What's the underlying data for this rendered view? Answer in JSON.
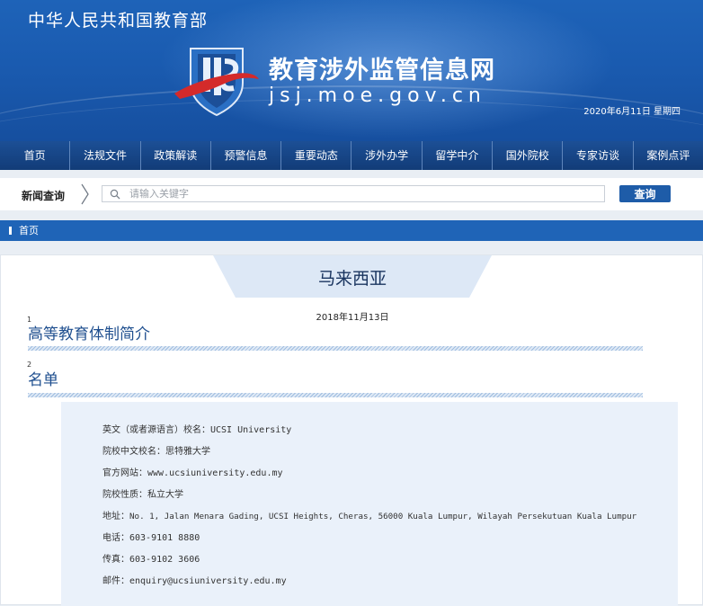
{
  "header": {
    "ministry": "中华人民共和国教育部",
    "site_name_cn": "教育涉外监管信息网",
    "site_name_en": "jsj.moe.gov.cn",
    "date": "2020年6月11日  星期四"
  },
  "nav": {
    "items": [
      "首页",
      "法规文件",
      "政策解读",
      "预警信息",
      "重要动态",
      "涉外办学",
      "留学中介",
      "国外院校",
      "专家访谈",
      "案例点评"
    ]
  },
  "search": {
    "label": "新闻查询",
    "placeholder": "请输入关键字",
    "button": "查询"
  },
  "breadcrumb": {
    "home": "首页"
  },
  "article": {
    "country": "马来西亚",
    "date": "2018年11月13日",
    "sections": [
      {
        "num": "1",
        "title": "高等教育体制简介"
      },
      {
        "num": "2",
        "title": "名单"
      }
    ],
    "info": [
      {
        "label": "英文（或者源语言）校名：",
        "value": "UCSI University"
      },
      {
        "label": "院校中文校名：",
        "value": "思特雅大学"
      },
      {
        "label": "官方网站：",
        "value": "www.ucsiuniversity.edu.my"
      },
      {
        "label": "院校性质：",
        "value": "私立大学"
      },
      {
        "label": "地址：",
        "value": "No. 1, Jalan Menara Gading, UCSI Heights, Cheras, 56000 Kuala Lumpur, Wilayah Persekutuan Kuala Lumpur"
      },
      {
        "label": "电话：",
        "value": "603-9101 8880"
      },
      {
        "label": "传真：",
        "value": "603-9102 3606"
      },
      {
        "label": "邮件：",
        "value": "enquiry@ucsiuniversity.edu.my"
      }
    ]
  },
  "colors": {
    "banner": "#1a5bb0",
    "nav": "#163f7d",
    "accent": "#1e5ca8",
    "logo_red": "#d42a2a"
  }
}
